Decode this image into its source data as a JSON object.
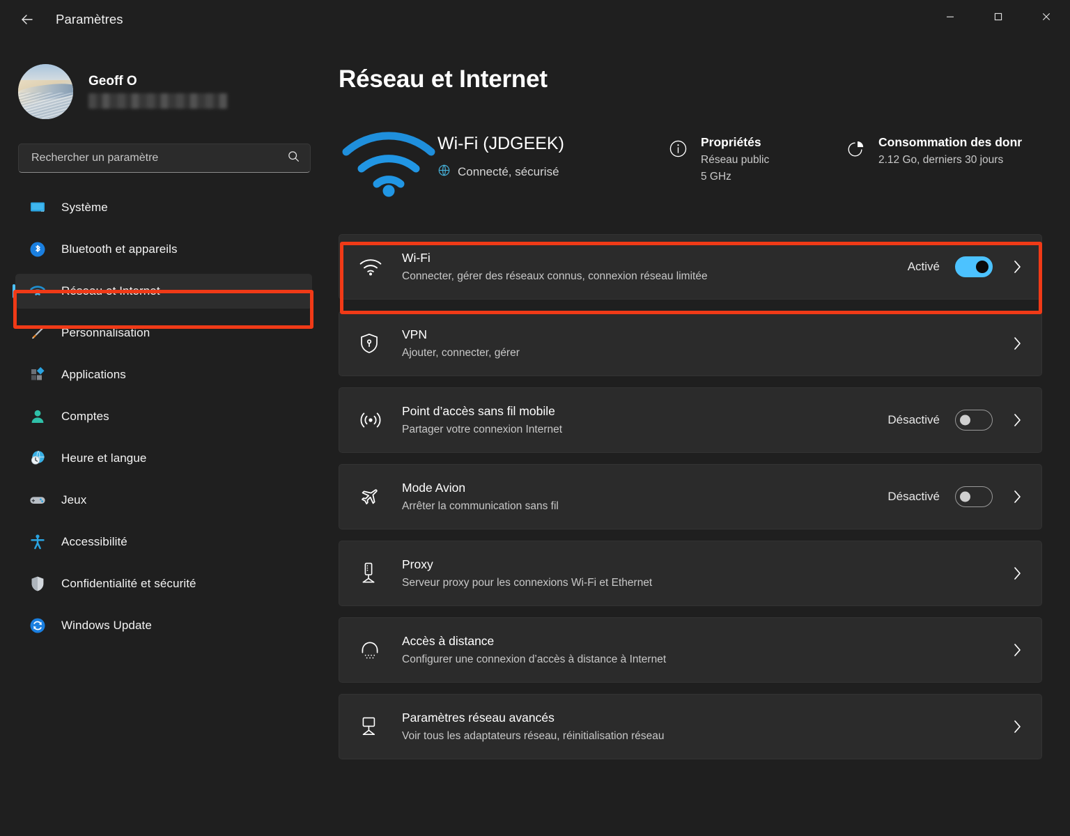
{
  "window": {
    "app_title": "Paramètres",
    "back_icon": "back-arrow-icon",
    "controls": {
      "minimize": "minimize-icon",
      "maximize": "maximize-icon",
      "close": "close-icon"
    }
  },
  "account": {
    "name": "Geoff O",
    "email_redacted": "",
    "avatar_alt": "avatar-image"
  },
  "search": {
    "placeholder": "Rechercher un paramètre",
    "value": "",
    "icon": "search-icon"
  },
  "sidebar": {
    "items": [
      {
        "label": "Système",
        "icon": "display-icon",
        "active": false
      },
      {
        "label": "Bluetooth et appareils",
        "icon": "bluetooth-icon",
        "active": false
      },
      {
        "label": "Réseau et Internet",
        "icon": "wifi-icon",
        "active": true
      },
      {
        "label": "Personnalisation",
        "icon": "paintbrush-icon",
        "active": false
      },
      {
        "label": "Applications",
        "icon": "apps-icon",
        "active": false
      },
      {
        "label": "Comptes",
        "icon": "person-icon",
        "active": false
      },
      {
        "label": "Heure et langue",
        "icon": "clock-globe-icon",
        "active": false
      },
      {
        "label": "Jeux",
        "icon": "gamepad-icon",
        "active": false
      },
      {
        "label": "Accessibilité",
        "icon": "accessibility-icon",
        "active": false
      },
      {
        "label": "Confidentialité et sécurité",
        "icon": "shield-icon",
        "active": false
      },
      {
        "label": "Windows Update",
        "icon": "update-icon",
        "active": false
      }
    ]
  },
  "main": {
    "page_title": "Réseau et Internet",
    "status": {
      "icon": "wifi-large-icon",
      "name": "Wi-Fi (JDGEEK)",
      "state_icon": "globe-icon",
      "state": "Connecté, sécurisé",
      "properties": {
        "icon": "info-icon",
        "heading": "Propriétés",
        "line1": "Réseau public",
        "line2": "5 GHz"
      },
      "data_usage": {
        "icon": "pie-chart-icon",
        "heading": "Consommation des donr",
        "line1": "2.12 Go, derniers 30 jours"
      }
    },
    "rows": [
      {
        "icon": "wifi-icon",
        "title": "Wi-Fi",
        "desc": "Connecter, gérer des réseaux connus, connexion réseau limitée",
        "toggle_label": "Activé",
        "toggle_state": "on",
        "chevron": "chevron-right-icon",
        "highlighted": true
      },
      {
        "icon": "vpn-shield-icon",
        "title": "VPN",
        "desc": "Ajouter, connecter, gérer",
        "toggle_label": "",
        "toggle_state": "none",
        "chevron": "chevron-right-icon",
        "highlighted": false
      },
      {
        "icon": "hotspot-icon",
        "title": "Point d’accès sans fil mobile",
        "desc": "Partager votre connexion Internet",
        "toggle_label": "Désactivé",
        "toggle_state": "off",
        "chevron": "chevron-right-icon",
        "highlighted": false
      },
      {
        "icon": "airplane-icon",
        "title": "Mode Avion",
        "desc": "Arrêter la communication sans fil",
        "toggle_label": "Désactivé",
        "toggle_state": "off",
        "chevron": "chevron-right-icon",
        "highlighted": false
      },
      {
        "icon": "proxy-server-icon",
        "title": "Proxy",
        "desc": "Serveur proxy pour les connexions Wi-Fi et Ethernet",
        "toggle_label": "",
        "toggle_state": "none",
        "chevron": "chevron-right-icon",
        "highlighted": false
      },
      {
        "icon": "dialup-icon",
        "title": "Accès à distance",
        "desc": "Configurer une connexion d’accès à distance à Internet",
        "toggle_label": "",
        "toggle_state": "none",
        "chevron": "chevron-right-icon",
        "highlighted": false
      },
      {
        "icon": "advanced-network-icon",
        "title": "Paramètres réseau avancés",
        "desc": "Voir tous les adaptateurs réseau, réinitialisation réseau",
        "toggle_label": "",
        "toggle_state": "none",
        "chevron": "chevron-right-icon",
        "highlighted": false
      }
    ]
  },
  "annotations": {
    "color": "#f03a17",
    "targets": [
      "sidebar-item-reseau-et-internet",
      "row-wifi"
    ]
  },
  "colors": {
    "accent": "#4cc2ff",
    "page_bg": "#1f1f1f",
    "card_bg": "#2b2b2b",
    "annotation": "#f03a17"
  }
}
